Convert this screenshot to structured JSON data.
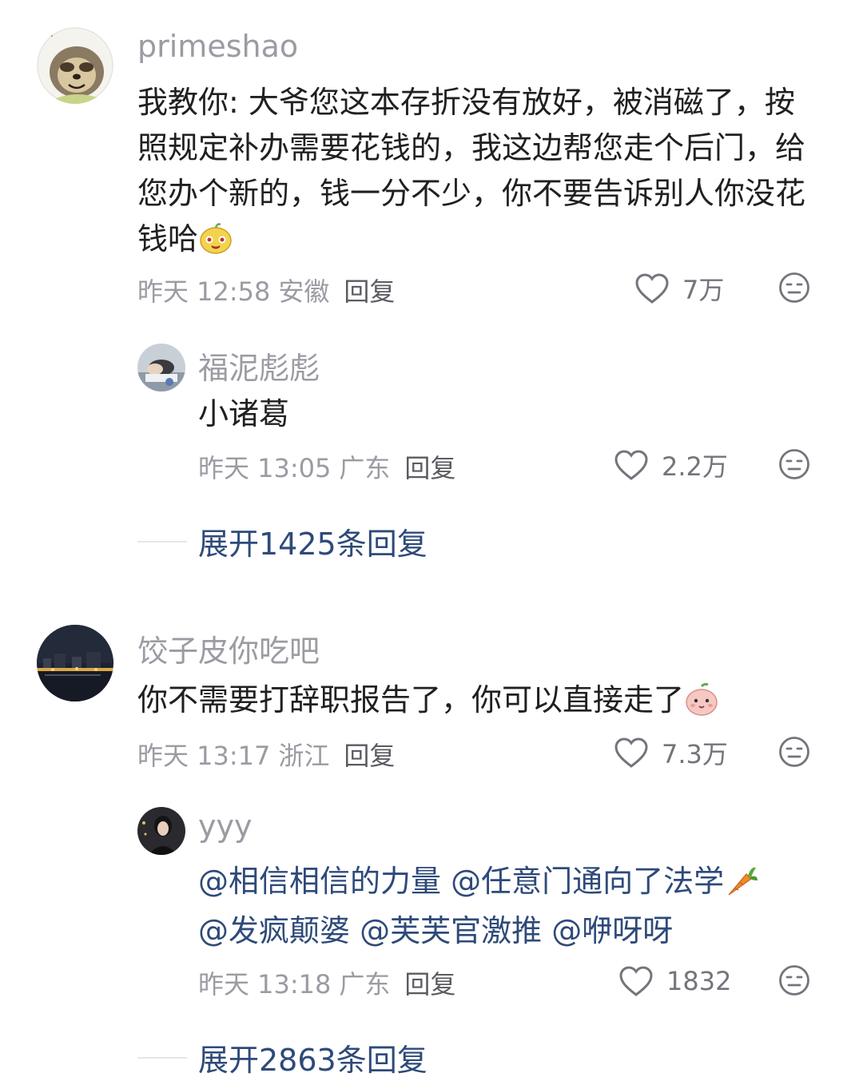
{
  "comments": [
    {
      "username": "primeshao",
      "avatar": "sloth-avatar-icon",
      "text": "我教你: 大爷您这本存折没有放好，被消磁了，按照规定补办需要花钱的，我这边帮您走个后门，给您办个新的，钱一分不少，你不要告诉别人你没花钱哈",
      "emoji": "smiling-cartoon-emoji",
      "time": "昨天 12:58",
      "location": "安徽",
      "reply": "回复",
      "likes": "7万",
      "replies": [
        {
          "username": "福泥彪彪",
          "avatar": "person-sleeping-avatar",
          "text": "小诸葛",
          "time": "昨天 13:05",
          "location": "广东",
          "reply": "回复",
          "likes": "2.2万"
        }
      ],
      "expand_label": "展开1425条回复"
    },
    {
      "username": "饺子皮你吃吧",
      "avatar": "night-city-avatar",
      "text": "你不需要打辞职报告了，你可以直接走了",
      "emoji": "pink-dumpling-emoji",
      "time": "昨天 13:17",
      "location": "浙江",
      "reply": "回复",
      "likes": "7.3万",
      "replies": [
        {
          "username": "yyy",
          "avatar": "person-dark-avatar",
          "mentions_line1": [
            "@相信相信的力量",
            "@任意门通向了法学"
          ],
          "mentions_line2": [
            "@发疯颠婆",
            "@芙芙官激推",
            "@咿呀呀"
          ],
          "emoji": "carrot-emoji",
          "time": "昨天 13:18",
          "location": "广东",
          "reply": "回复",
          "likes": "1832"
        }
      ],
      "expand_label": "展开2863条回复"
    }
  ],
  "colors": {
    "username": "#9b9ba3",
    "text": "#202022",
    "link": "#2e4a7a",
    "meta": "#9b9ba3"
  }
}
